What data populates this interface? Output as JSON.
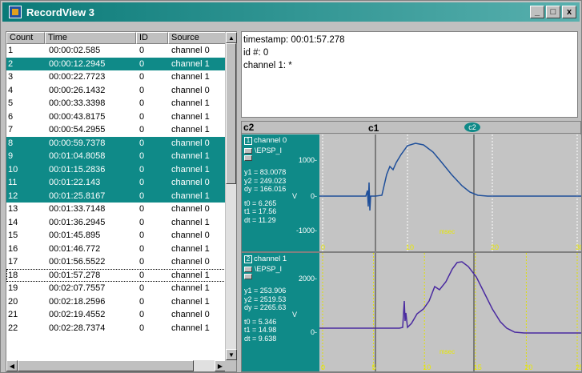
{
  "window": {
    "title": "RecordView 3",
    "minimize": "_",
    "restore": "□",
    "close": "x"
  },
  "list": {
    "headers": {
      "count": "Count",
      "time": "Time",
      "id": "ID",
      "source": "Source"
    },
    "rows": [
      {
        "count": "1",
        "time": "00:00:02.585",
        "id": "0",
        "source": "channel 0",
        "selected": false
      },
      {
        "count": "2",
        "time": "00:00:12.2945",
        "id": "0",
        "source": "channel 1",
        "selected": true
      },
      {
        "count": "3",
        "time": "00:00:22.7723",
        "id": "0",
        "source": "channel 1",
        "selected": false
      },
      {
        "count": "4",
        "time": "00:00:26.1432",
        "id": "0",
        "source": "channel 0",
        "selected": false
      },
      {
        "count": "5",
        "time": "00:00:33.3398",
        "id": "0",
        "source": "channel 1",
        "selected": false
      },
      {
        "count": "6",
        "time": "00:00:43.8175",
        "id": "0",
        "source": "channel 1",
        "selected": false
      },
      {
        "count": "7",
        "time": "00:00:54.2955",
        "id": "0",
        "source": "channel 1",
        "selected": false
      },
      {
        "count": "8",
        "time": "00:00:59.7378",
        "id": "0",
        "source": "channel 0",
        "selected": true
      },
      {
        "count": "9",
        "time": "00:01:04.8058",
        "id": "0",
        "source": "channel 1",
        "selected": true
      },
      {
        "count": "10",
        "time": "00:01:15.2836",
        "id": "0",
        "source": "channel 1",
        "selected": true
      },
      {
        "count": "11",
        "time": "00:01:22.143",
        "id": "0",
        "source": "channel 0",
        "selected": true
      },
      {
        "count": "12",
        "time": "00:01:25.8167",
        "id": "0",
        "source": "channel 1",
        "selected": true
      },
      {
        "count": "13",
        "time": "00:01:33.7148",
        "id": "0",
        "source": "channel 0",
        "selected": false
      },
      {
        "count": "14",
        "time": "00:01:36.2945",
        "id": "0",
        "source": "channel 1",
        "selected": false
      },
      {
        "count": "15",
        "time": "00:01:45.895",
        "id": "0",
        "source": "channel 0",
        "selected": false
      },
      {
        "count": "16",
        "time": "00:01:46.772",
        "id": "0",
        "source": "channel 1",
        "selected": false
      },
      {
        "count": "17",
        "time": "00:01:56.5522",
        "id": "0",
        "source": "channel 0",
        "selected": false
      },
      {
        "count": "18",
        "time": "00:01:57.278",
        "id": "0",
        "source": "channel 1",
        "selected": false,
        "focused": true
      },
      {
        "count": "19",
        "time": "00:02:07.7557",
        "id": "0",
        "source": "channel 1",
        "selected": false
      },
      {
        "count": "20",
        "time": "00:02:18.2596",
        "id": "0",
        "source": "channel 1",
        "selected": false
      },
      {
        "count": "21",
        "time": "00:02:19.4552",
        "id": "0",
        "source": "channel 0",
        "selected": false
      },
      {
        "count": "22",
        "time": "00:02:28.7374",
        "id": "0",
        "source": "channel 1",
        "selected": false
      }
    ]
  },
  "info": {
    "timestamp": "timestamp: 00:01:57.278",
    "id": "id #: 0",
    "channel": "channel 1: *"
  },
  "scope": {
    "cursor_left": "c2",
    "cursor_1": "c1",
    "cursor_2_badge": "c2",
    "channels": [
      {
        "num": "1",
        "name": "channel 0",
        "units": "\\EPSP_I",
        "y1": "y1 = 83.0078",
        "y2": "y2 = 249.023",
        "dy": "dy = 166.016",
        "unit_v": "V",
        "t0": "t0 = 6.265",
        "t1": "t1 = 17.56",
        "dt": "dt = 11.29",
        "ytick_top": "1000-",
        "ytick_mid": "0-",
        "ytick_bot": "-1000-",
        "xticks": [
          "0",
          "10",
          "20",
          "30"
        ],
        "xunit": "msec",
        "trace_color": "#1f4f9a"
      },
      {
        "num": "2",
        "name": "channel 1",
        "units": "\\EPSP_I",
        "y1": "y1 = 253.906",
        "y2": "y2 = 2519.53",
        "dy": "dy = 2265.63",
        "unit_v": "V",
        "t0": "t0 = 5.346",
        "t1": "t1 = 14.98",
        "dt": "dt = 9.638",
        "ytick_top": "2000-",
        "ytick_mid": "0-",
        "xticks": [
          "0",
          "5",
          "10",
          "15",
          "20",
          "25"
        ],
        "xunit": "msec",
        "trace_color": "#4a2aa0"
      }
    ]
  },
  "colors": {
    "selection": "#0f8a88",
    "title_start": "#0a7a78",
    "grid_top": "#ffffff",
    "grid_bottom": "#e0e000"
  }
}
